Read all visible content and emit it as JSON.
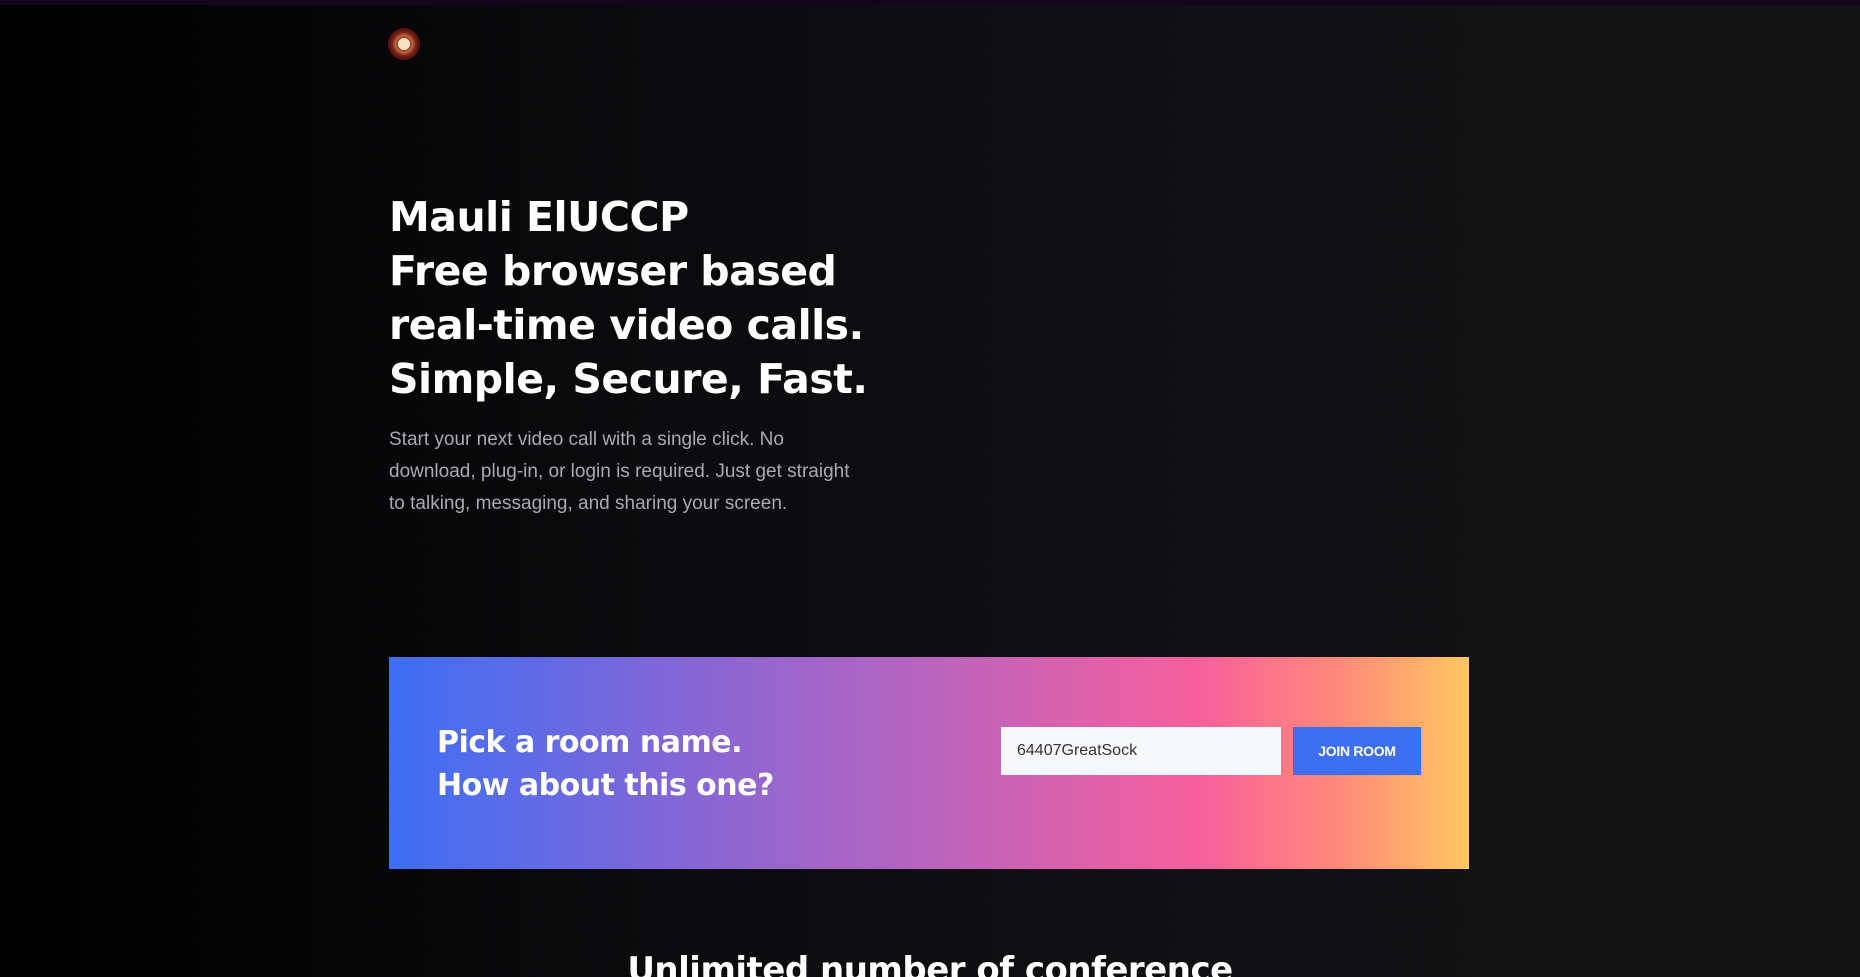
{
  "logo": {
    "icon": "logo-emblem-icon"
  },
  "hero": {
    "title_lines": [
      "Mauli ElUCCP",
      "Free browser based",
      "real-time video calls.",
      "Simple, Secure, Fast."
    ],
    "description": "Start your next video call with a single click. No download, plug-in, or login is required. Just get straight to talking, messaging, and sharing your screen."
  },
  "room": {
    "prompt_lines": [
      "Pick a room name.",
      "How about this one?"
    ],
    "input_value": "64407GreatSock",
    "join_label": "JOIN ROOM"
  },
  "features": {
    "title": "Unlimited number of conference"
  },
  "colors": {
    "banner_start": "#3c6ff5",
    "banner_mid": "#f85f9c",
    "banner_end": "#ffc660",
    "button": "#3e6ff0"
  }
}
